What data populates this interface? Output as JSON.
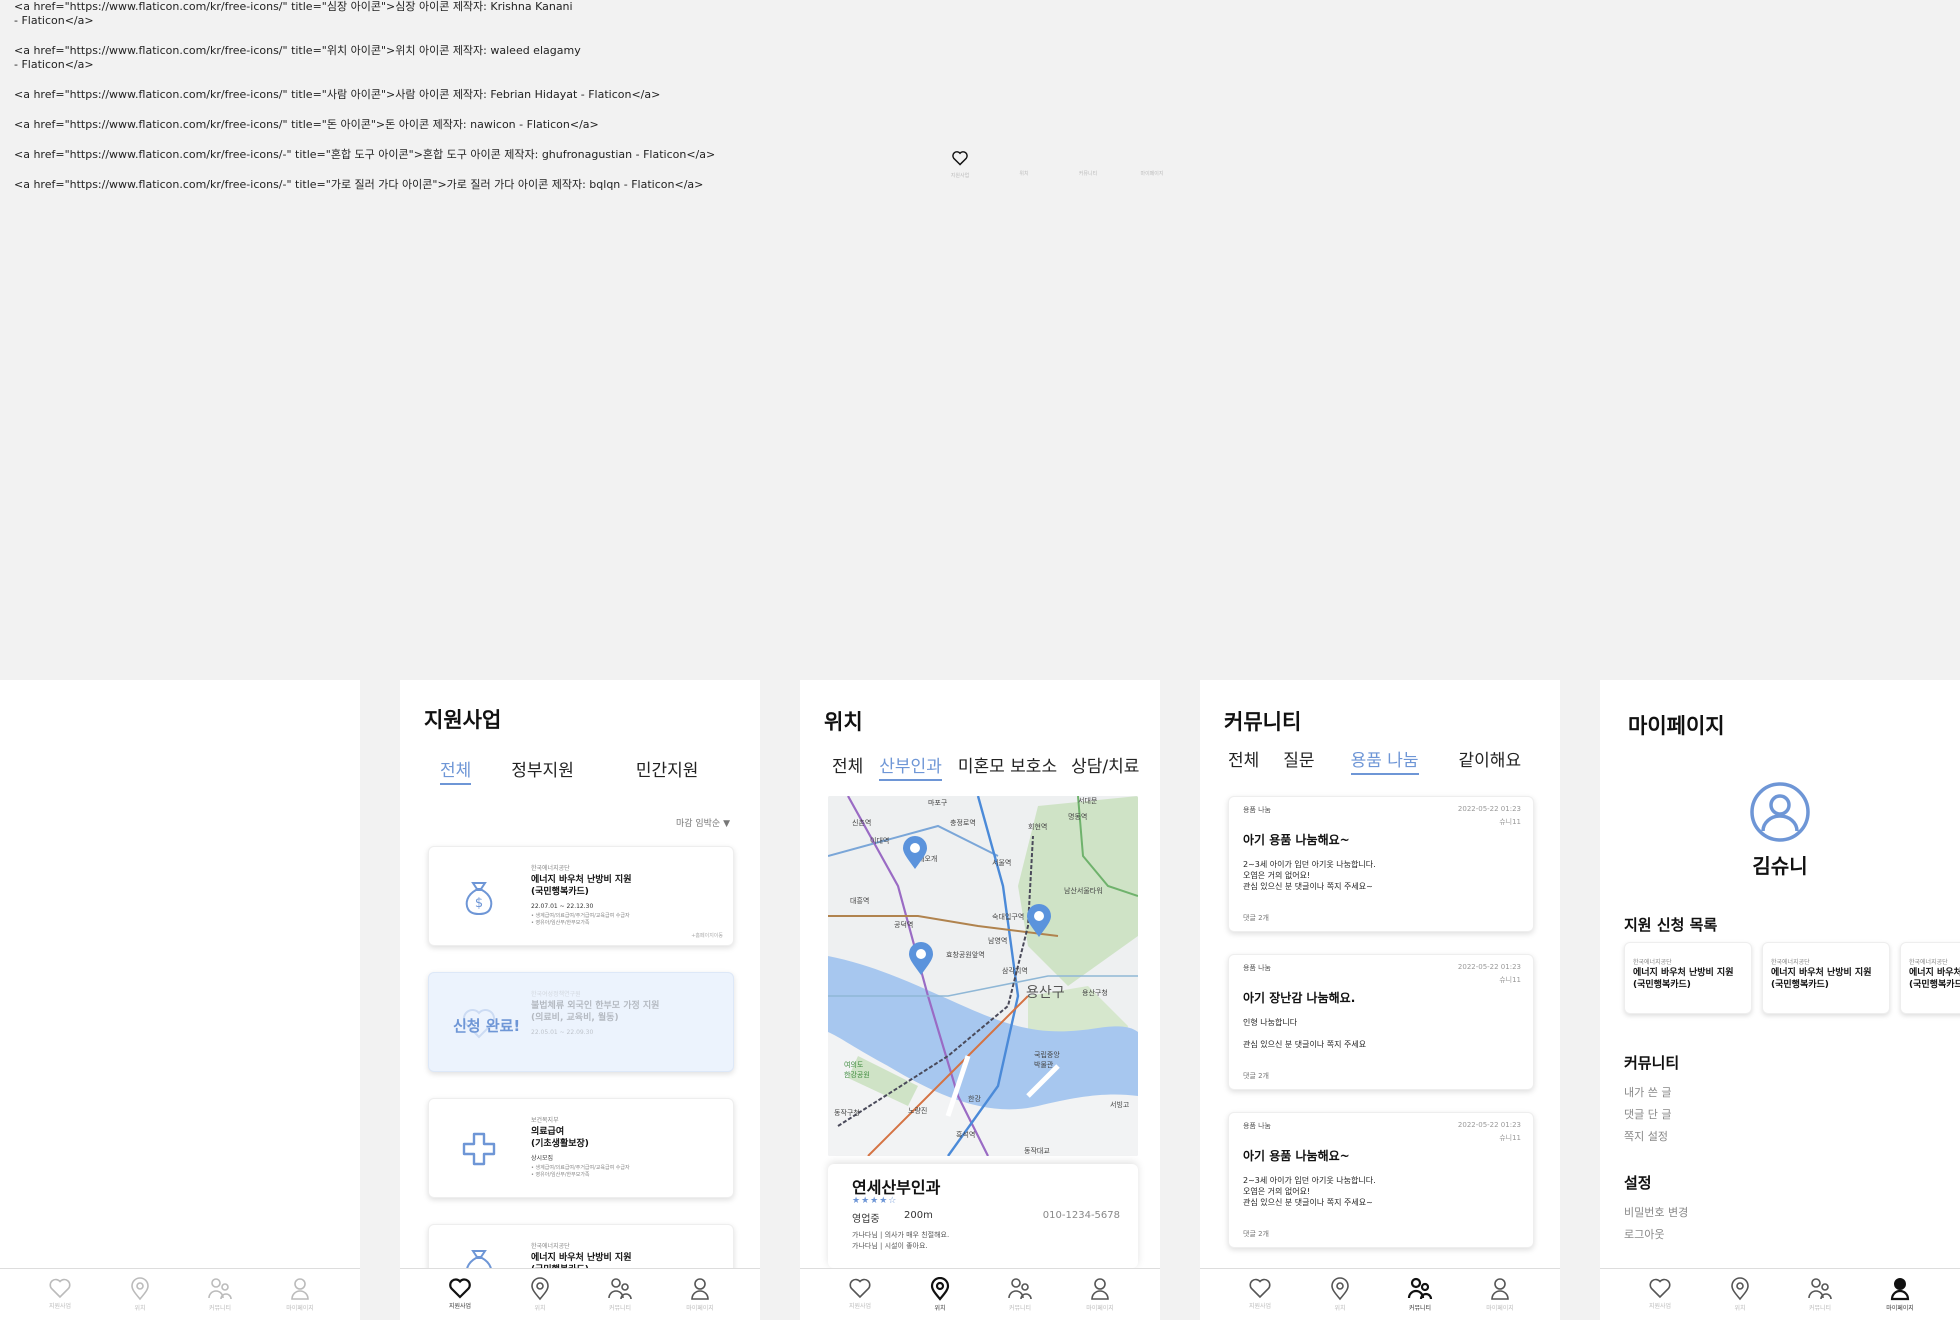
{
  "credits": [
    "<a href=\"https://www.flaticon.com/kr/free-icons/\" title=\"심장 아이콘\">심장 아이콘  제작자: Krishna Kanani\n- Flaticon</a>",
    "<a href=\"https://www.flaticon.com/kr/free-icons/\" title=\"위치 아이콘\">위치 아이콘  제작자: waleed elagamy\n- Flaticon</a>",
    "<a href=\"https://www.flaticon.com/kr/free-icons/\" title=\"사람 아이콘\">사람 아이콘  제작자: Febrian Hidayat - Flaticon</a>",
    "<a href=\"https://www.flaticon.com/kr/free-icons/\" title=\"돈 아이콘\">돈 아이콘  제작자: nawicon - Flaticon</a>",
    "<a href=\"https://www.flaticon.com/kr/free-icons/-\" title=\"혼합 도구 아이콘\">혼합 도구 아이콘  제작자: ghufronagustian - Flaticon</a>",
    "<a href=\"https://www.flaticon.com/kr/free-icons/-\" title=\"가로 질러 가다 아이콘\">가로 질러 가다 아이콘  제작자: bqlqn - Flaticon</a>"
  ],
  "nav": {
    "support": "지원사업",
    "location": "위치",
    "community": "커뮤니티",
    "mypage": "마이페이지"
  },
  "support": {
    "title": "지원사업",
    "tabs": [
      "전체",
      "정부지원",
      "민간지원"
    ],
    "sort": "마감 임박순 ▼",
    "cards": [
      {
        "org": "한국에너지공단",
        "title": "에너지 바우처 난방비 지원\n(국민행복카드)",
        "period": "22.07.01 ~ 22.12.30",
        "details": [
          "생계급여/의료급여/주거급여/교육급여 수급자",
          "영유아/임산부/한부모가족"
        ],
        "link": "+홈페이지이동",
        "icon": "money-bag-icon"
      },
      {
        "org": "한국여성정책연구원",
        "title": "불법체류 외국인 한부모 가정 지원\n(의료비, 교육비, 월동)",
        "period": "22.05.01 ~ 22.09.30",
        "details": [],
        "link": "",
        "stamp": "신청 완료!",
        "icon": "heart-icon"
      },
      {
        "org": "보건복지부",
        "title": "의료급여\n(기초생활보장)",
        "period": "상시모집",
        "details": [
          "생계급여/의료급여/주거급여/교육급여 수급자",
          "영유아/임산부/한부모가족"
        ],
        "link": "",
        "icon": "medical-cross-icon"
      },
      {
        "org": "한국에너지공단",
        "title": "에너지 바우처 난방비 지원\n(국민행복카드)",
        "period": "",
        "details": [],
        "link": "",
        "icon": "money-bag-icon"
      }
    ]
  },
  "location": {
    "title": "위치",
    "tabs": [
      "전체",
      "산부인과",
      "미혼모 보호소",
      "상담/치료"
    ],
    "map_labels": [
      "신촌역",
      "이대역",
      "충정로역",
      "서울역",
      "회현역",
      "명동역",
      "대흥역",
      "공덕역",
      "애오개",
      "남산서울타워",
      "숙대입구역",
      "효창공원앞역",
      "삼각지역",
      "용산구",
      "용산구청",
      "남영역",
      "국립중앙\n박물관",
      "여의도\n한강공원",
      "동작구청",
      "노량진",
      "한강",
      "흑석역",
      "동작대교",
      "서빙고",
      "서대문",
      "마포구"
    ],
    "place": {
      "name": "연세산부인과",
      "stars": "★★★★☆",
      "status": "영업중",
      "distance": "200m",
      "phone": "010-1234-5678",
      "review1": "가나다님 | 의사가 매우 친절해요.",
      "review2": "가나다님 | 시설이 좋아요."
    }
  },
  "community": {
    "title": "커뮤니티",
    "tabs": [
      "전체",
      "질문",
      "용품 나눔",
      "같이해요"
    ],
    "posts": [
      {
        "category": "용품 나눔",
        "date": "2022-05-22 01:23",
        "author": "슈니11",
        "title": "아기 용품 나눔해요~",
        "body": [
          "2~3세 아이가 입던 아기옷 나눔합니다.",
          "오염은 거의 없어요!",
          "관심 있으신 분 댓글이나 쪽지 주세요~"
        ],
        "comments": "댓글 2개"
      },
      {
        "category": "용품 나눔",
        "date": "2022-05-22 01:23",
        "author": "슈니11",
        "title": "아기 장난감 나눔해요.",
        "body": [
          "인형 나눔합니다",
          "",
          "관심 있으신 분 댓글이나 쪽지 주세요"
        ],
        "comments": "댓글 2개"
      },
      {
        "category": "용품 나눔",
        "date": "2022-05-22 01:23",
        "author": "슈니11",
        "title": "아기 용품 나눔해요~",
        "body": [
          "2~3세 아이가 입던 아기옷 나눔합니다.",
          "오염은 거의 없어요!",
          "관심 있으신 분 댓글이나 쪽지 주세요~"
        ],
        "comments": "댓글 2개"
      }
    ]
  },
  "mypage": {
    "title": "마이페이지",
    "username": "김슈니",
    "applications_heading": "지원 신청 목록",
    "applications": [
      {
        "org": "한국에너지공단",
        "title": "에너지 바우처 난방비 지원\n(국민행복카드)"
      },
      {
        "org": "한국에너지공단",
        "title": "에너지 바우처 난방비 지원\n(국민행복카드)"
      },
      {
        "org": "한국에너지공단",
        "title": "에너지 바우처 난방비 지원\n(국민행복카드)"
      }
    ],
    "community_heading": "커뮤니티",
    "community_items": [
      "내가 쓴 글",
      "댓글 단 글",
      "쪽지 설정"
    ],
    "settings_heading": "설정",
    "settings_items": [
      "비밀번호 변경",
      "로그아웃"
    ]
  },
  "colors": {
    "accent": "#6e96d6",
    "card_done_bg": "#ecf3fd",
    "background": "#f2f2f2"
  }
}
